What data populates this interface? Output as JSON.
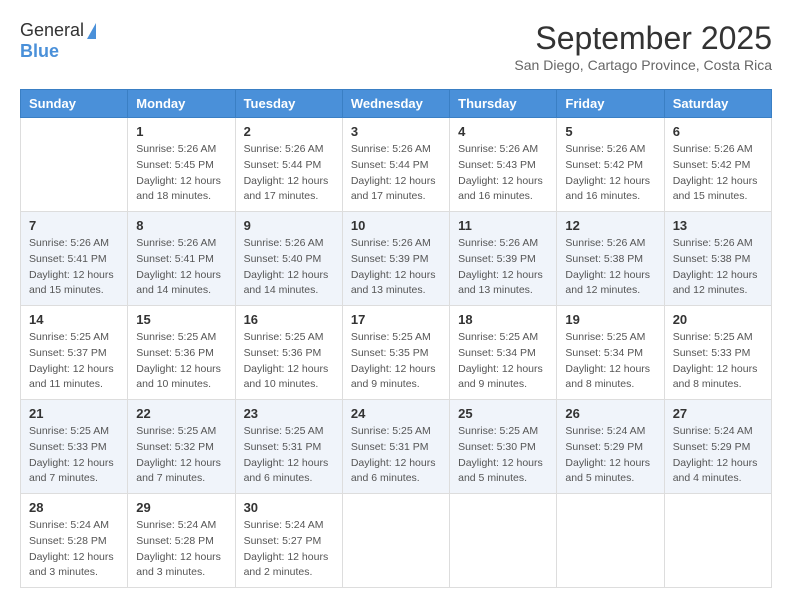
{
  "logo": {
    "general": "General",
    "blue": "Blue"
  },
  "title": "September 2025",
  "subtitle": "San Diego, Cartago Province, Costa Rica",
  "weekdays": [
    "Sunday",
    "Monday",
    "Tuesday",
    "Wednesday",
    "Thursday",
    "Friday",
    "Saturday"
  ],
  "weeks": [
    [
      {
        "day": "",
        "info": ""
      },
      {
        "day": "1",
        "info": "Sunrise: 5:26 AM\nSunset: 5:45 PM\nDaylight: 12 hours\nand 18 minutes."
      },
      {
        "day": "2",
        "info": "Sunrise: 5:26 AM\nSunset: 5:44 PM\nDaylight: 12 hours\nand 17 minutes."
      },
      {
        "day": "3",
        "info": "Sunrise: 5:26 AM\nSunset: 5:44 PM\nDaylight: 12 hours\nand 17 minutes."
      },
      {
        "day": "4",
        "info": "Sunrise: 5:26 AM\nSunset: 5:43 PM\nDaylight: 12 hours\nand 16 minutes."
      },
      {
        "day": "5",
        "info": "Sunrise: 5:26 AM\nSunset: 5:42 PM\nDaylight: 12 hours\nand 16 minutes."
      },
      {
        "day": "6",
        "info": "Sunrise: 5:26 AM\nSunset: 5:42 PM\nDaylight: 12 hours\nand 15 minutes."
      }
    ],
    [
      {
        "day": "7",
        "info": "Sunrise: 5:26 AM\nSunset: 5:41 PM\nDaylight: 12 hours\nand 15 minutes."
      },
      {
        "day": "8",
        "info": "Sunrise: 5:26 AM\nSunset: 5:41 PM\nDaylight: 12 hours\nand 14 minutes."
      },
      {
        "day": "9",
        "info": "Sunrise: 5:26 AM\nSunset: 5:40 PM\nDaylight: 12 hours\nand 14 minutes."
      },
      {
        "day": "10",
        "info": "Sunrise: 5:26 AM\nSunset: 5:39 PM\nDaylight: 12 hours\nand 13 minutes."
      },
      {
        "day": "11",
        "info": "Sunrise: 5:26 AM\nSunset: 5:39 PM\nDaylight: 12 hours\nand 13 minutes."
      },
      {
        "day": "12",
        "info": "Sunrise: 5:26 AM\nSunset: 5:38 PM\nDaylight: 12 hours\nand 12 minutes."
      },
      {
        "day": "13",
        "info": "Sunrise: 5:26 AM\nSunset: 5:38 PM\nDaylight: 12 hours\nand 12 minutes."
      }
    ],
    [
      {
        "day": "14",
        "info": "Sunrise: 5:25 AM\nSunset: 5:37 PM\nDaylight: 12 hours\nand 11 minutes."
      },
      {
        "day": "15",
        "info": "Sunrise: 5:25 AM\nSunset: 5:36 PM\nDaylight: 12 hours\nand 10 minutes."
      },
      {
        "day": "16",
        "info": "Sunrise: 5:25 AM\nSunset: 5:36 PM\nDaylight: 12 hours\nand 10 minutes."
      },
      {
        "day": "17",
        "info": "Sunrise: 5:25 AM\nSunset: 5:35 PM\nDaylight: 12 hours\nand 9 minutes."
      },
      {
        "day": "18",
        "info": "Sunrise: 5:25 AM\nSunset: 5:34 PM\nDaylight: 12 hours\nand 9 minutes."
      },
      {
        "day": "19",
        "info": "Sunrise: 5:25 AM\nSunset: 5:34 PM\nDaylight: 12 hours\nand 8 minutes."
      },
      {
        "day": "20",
        "info": "Sunrise: 5:25 AM\nSunset: 5:33 PM\nDaylight: 12 hours\nand 8 minutes."
      }
    ],
    [
      {
        "day": "21",
        "info": "Sunrise: 5:25 AM\nSunset: 5:33 PM\nDaylight: 12 hours\nand 7 minutes."
      },
      {
        "day": "22",
        "info": "Sunrise: 5:25 AM\nSunset: 5:32 PM\nDaylight: 12 hours\nand 7 minutes."
      },
      {
        "day": "23",
        "info": "Sunrise: 5:25 AM\nSunset: 5:31 PM\nDaylight: 12 hours\nand 6 minutes."
      },
      {
        "day": "24",
        "info": "Sunrise: 5:25 AM\nSunset: 5:31 PM\nDaylight: 12 hours\nand 6 minutes."
      },
      {
        "day": "25",
        "info": "Sunrise: 5:25 AM\nSunset: 5:30 PM\nDaylight: 12 hours\nand 5 minutes."
      },
      {
        "day": "26",
        "info": "Sunrise: 5:24 AM\nSunset: 5:29 PM\nDaylight: 12 hours\nand 5 minutes."
      },
      {
        "day": "27",
        "info": "Sunrise: 5:24 AM\nSunset: 5:29 PM\nDaylight: 12 hours\nand 4 minutes."
      }
    ],
    [
      {
        "day": "28",
        "info": "Sunrise: 5:24 AM\nSunset: 5:28 PM\nDaylight: 12 hours\nand 3 minutes."
      },
      {
        "day": "29",
        "info": "Sunrise: 5:24 AM\nSunset: 5:28 PM\nDaylight: 12 hours\nand 3 minutes."
      },
      {
        "day": "30",
        "info": "Sunrise: 5:24 AM\nSunset: 5:27 PM\nDaylight: 12 hours\nand 2 minutes."
      },
      {
        "day": "",
        "info": ""
      },
      {
        "day": "",
        "info": ""
      },
      {
        "day": "",
        "info": ""
      },
      {
        "day": "",
        "info": ""
      }
    ]
  ]
}
